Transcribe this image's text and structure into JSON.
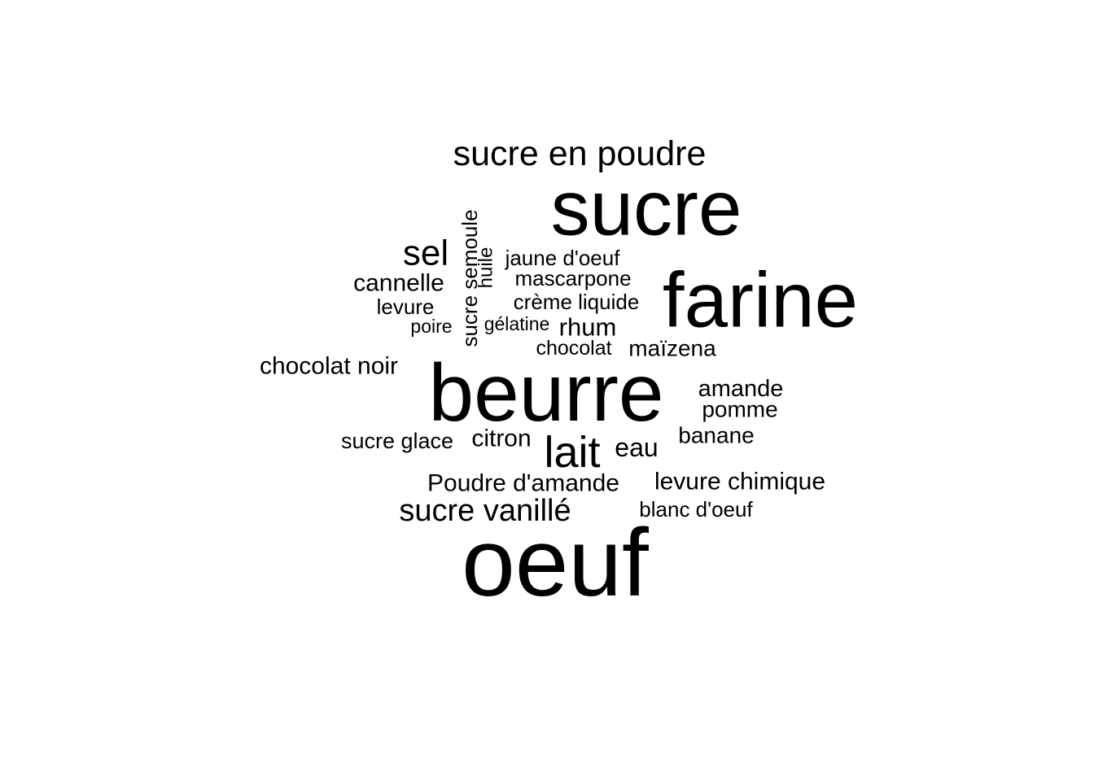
{
  "word_cloud": {
    "color": "#000000",
    "background": "#ffffff",
    "words": [
      {
        "text": "oeuf",
        "rotated": false
      },
      {
        "text": "beurre",
        "rotated": false
      },
      {
        "text": "farine",
        "rotated": false
      },
      {
        "text": "sucre",
        "rotated": false
      },
      {
        "text": "sucre en poudre",
        "rotated": false
      },
      {
        "text": "lait",
        "rotated": false
      },
      {
        "text": "sel",
        "rotated": false
      },
      {
        "text": "sucre vanillé",
        "rotated": false
      },
      {
        "text": "chocolat noir",
        "rotated": false
      },
      {
        "text": "levure chimique",
        "rotated": false
      },
      {
        "text": "Poudre d'amande",
        "rotated": false
      },
      {
        "text": "cannelle",
        "rotated": false
      },
      {
        "text": "amande",
        "rotated": false
      },
      {
        "text": "eau",
        "rotated": false
      },
      {
        "text": "citron",
        "rotated": false
      },
      {
        "text": "sucre glace",
        "rotated": false
      },
      {
        "text": "banane",
        "rotated": false
      },
      {
        "text": "pomme",
        "rotated": false
      },
      {
        "text": "maïzena",
        "rotated": false
      },
      {
        "text": "rhum",
        "rotated": false
      },
      {
        "text": "mascarpone",
        "rotated": false
      },
      {
        "text": "jaune d'oeuf",
        "rotated": false
      },
      {
        "text": "crème liquide",
        "rotated": false
      },
      {
        "text": "levure",
        "rotated": false
      },
      {
        "text": "blanc d'oeuf",
        "rotated": false
      },
      {
        "text": "chocolat",
        "rotated": false
      },
      {
        "text": "gélatine",
        "rotated": false
      },
      {
        "text": "poire",
        "rotated": false
      },
      {
        "text": "sucre semoule",
        "rotated": true
      },
      {
        "text": "huile",
        "rotated": true
      }
    ]
  }
}
